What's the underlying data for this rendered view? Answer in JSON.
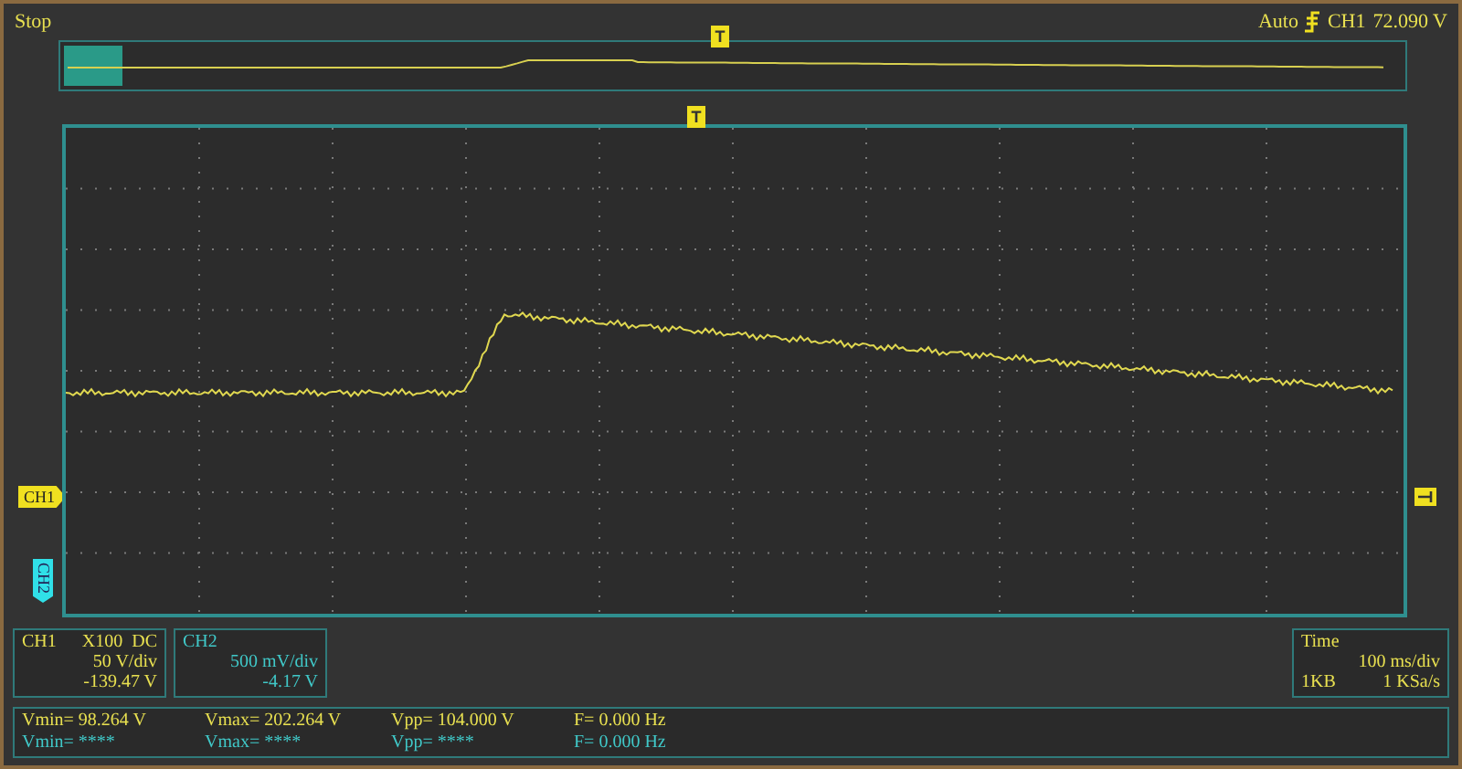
{
  "status": "Stop",
  "trigger": {
    "mode": "Auto",
    "source": "CH1",
    "level": "72.090 V"
  },
  "overview": {
    "marker": "T"
  },
  "grid": {
    "trigger_marker": "T",
    "ch1_marker": "CH1",
    "ch2_marker": "CH2"
  },
  "channels": [
    {
      "name": "CH1",
      "probe": "X100",
      "coupling": "DC",
      "scale": "50 V/div",
      "offset": "-139.47 V",
      "color": "#e8e050"
    },
    {
      "name": "CH2",
      "scale": "500 mV/div",
      "offset": "-4.17 V",
      "color": "#40c8c8"
    }
  ],
  "timebase": {
    "title": "Time",
    "scale": "100 ms/div",
    "depth": "1KB",
    "rate": "1 KSa/s"
  },
  "measurements": [
    {
      "color": "#e8e050",
      "items": [
        "Vmin= 98.264 V",
        "Vmax= 202.264 V",
        "Vpp= 104.000 V",
        "F= 0.000 Hz"
      ]
    },
    {
      "color": "#40c8c8",
      "items": [
        "Vmin= ****",
        "Vmax= ****",
        "Vpp= ****",
        "F= 0.000 Hz"
      ]
    }
  ]
}
